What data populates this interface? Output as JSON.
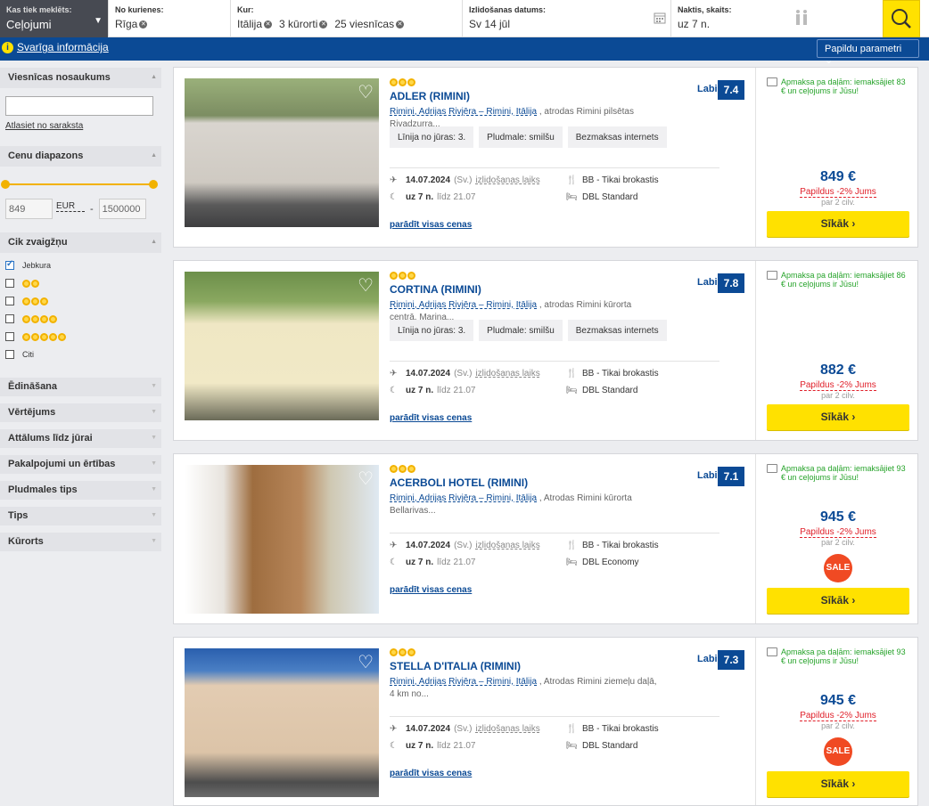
{
  "search": {
    "kas_label": "Kas tiek meklēts:",
    "kas_value": "Ceļojumi",
    "from_label": "No kurienes:",
    "from_value": "Rīga",
    "where_label": "Kur:",
    "where_country": "Itālija",
    "where_resorts": "3 kūrorti",
    "where_hotels": "25 viesnīcas",
    "date_label": "Izlidošanas datums:",
    "date_value": "Sv 14 jūl",
    "nights_label": "Naktis, skaits:",
    "nights_value": "uz 7 n."
  },
  "bluebar": {
    "info": "Svarīga informācija",
    "more_params": "Papildu parametri"
  },
  "sidebar": {
    "hotel_name_head": "Viesnīcas nosaukums",
    "select_from_list": "Atlasiet no saraksta",
    "price_head": "Cenu diapazons",
    "price_min": "849",
    "currency": "EUR",
    "dash": "-",
    "price_max": "1500000",
    "stars_head": "Cik zvaigžņu",
    "any": "Jebkura",
    "other": "Citi",
    "sections": [
      "Ēdināšana",
      "Vērtējums",
      "Attālums līdz jūrai",
      "Pakalpojumi un ērtības",
      "Pludmales tips",
      "Tips",
      "Kūrorts"
    ]
  },
  "common": {
    "heart": "♡",
    "dep_suffix": "(Sv.)",
    "dep_time": "izlidošanas laiks",
    "nights": "uz 7 n.",
    "until": "līdz 21.07",
    "all_prices": "parādīt visas cenas",
    "discount": "Papildus -2% Jums",
    "per": "par 2 cilv.",
    "more": "Sīkāk ›",
    "sale": "SALE",
    "score_label": "Labi"
  },
  "hotels": [
    {
      "name": "ADLER (RIMINI)",
      "score": "7.4",
      "loc_link": "Rimini, Adrijas Rivjēra – Rimini, Itālija",
      "loc_text": ", atrodas Rimini pilsētas Rivadzurra...",
      "tags": [
        "Līnija no jūras: 3.",
        "Pludmale: smilšu",
        "Bezmaksas internets"
      ],
      "date": "14.07.2024",
      "board": "BB - Tikai brokastis",
      "room": "DBL Standard",
      "pay": "Apmaksa pa daļām: iemaksājiet 83 € un ceļojums ir Jūsu!",
      "price": "849 €"
    },
    {
      "name": "CORTINA (RIMINI)",
      "score": "7.8",
      "loc_link": "Rimini, Adrijas Rivjēra – Rimini, Itālija",
      "loc_text": ", atrodas Rimini kūrorta centrā, Marina...",
      "tags": [
        "Līnija no jūras: 3.",
        "Pludmale: smilšu",
        "Bezmaksas internets"
      ],
      "date": "14.07.2024",
      "board": "BB - Tikai brokastis",
      "room": "DBL Standard",
      "pay": "Apmaksa pa daļām: iemaksājiet 86 € un ceļojums ir Jūsu!",
      "price": "882 €"
    },
    {
      "name": "ACERBOLI HOTEL (RIMINI)",
      "score": "7.1",
      "loc_link": "Rimini, Adrijas Rivjēra – Rimini, Itālija",
      "loc_text": ", Atrodas Rimini kūrorta Bellarivas...",
      "tags": [],
      "date": "14.07.2024",
      "board": "BB - Tikai brokastis",
      "room": "DBL Economy",
      "pay": "Apmaksa pa daļām: iemaksājiet 93 € un ceļojums ir Jūsu!",
      "price": "945 €"
    },
    {
      "name": "STELLA D'ITALIA (RIMINI)",
      "score": "7.3",
      "loc_link": "Rimini, Adrijas Rivjēra – Rimini, Itālija",
      "loc_text": ", Atrodas Rimini ziemeļu daļā, 4 km no...",
      "tags": [],
      "date": "14.07.2024",
      "board": "BB - Tikai brokastis",
      "room": "DBL Standard",
      "pay": "Apmaksa pa daļām: iemaksājiet 93 € un ceļojums ir Jūsu!",
      "price": "945 €"
    }
  ]
}
